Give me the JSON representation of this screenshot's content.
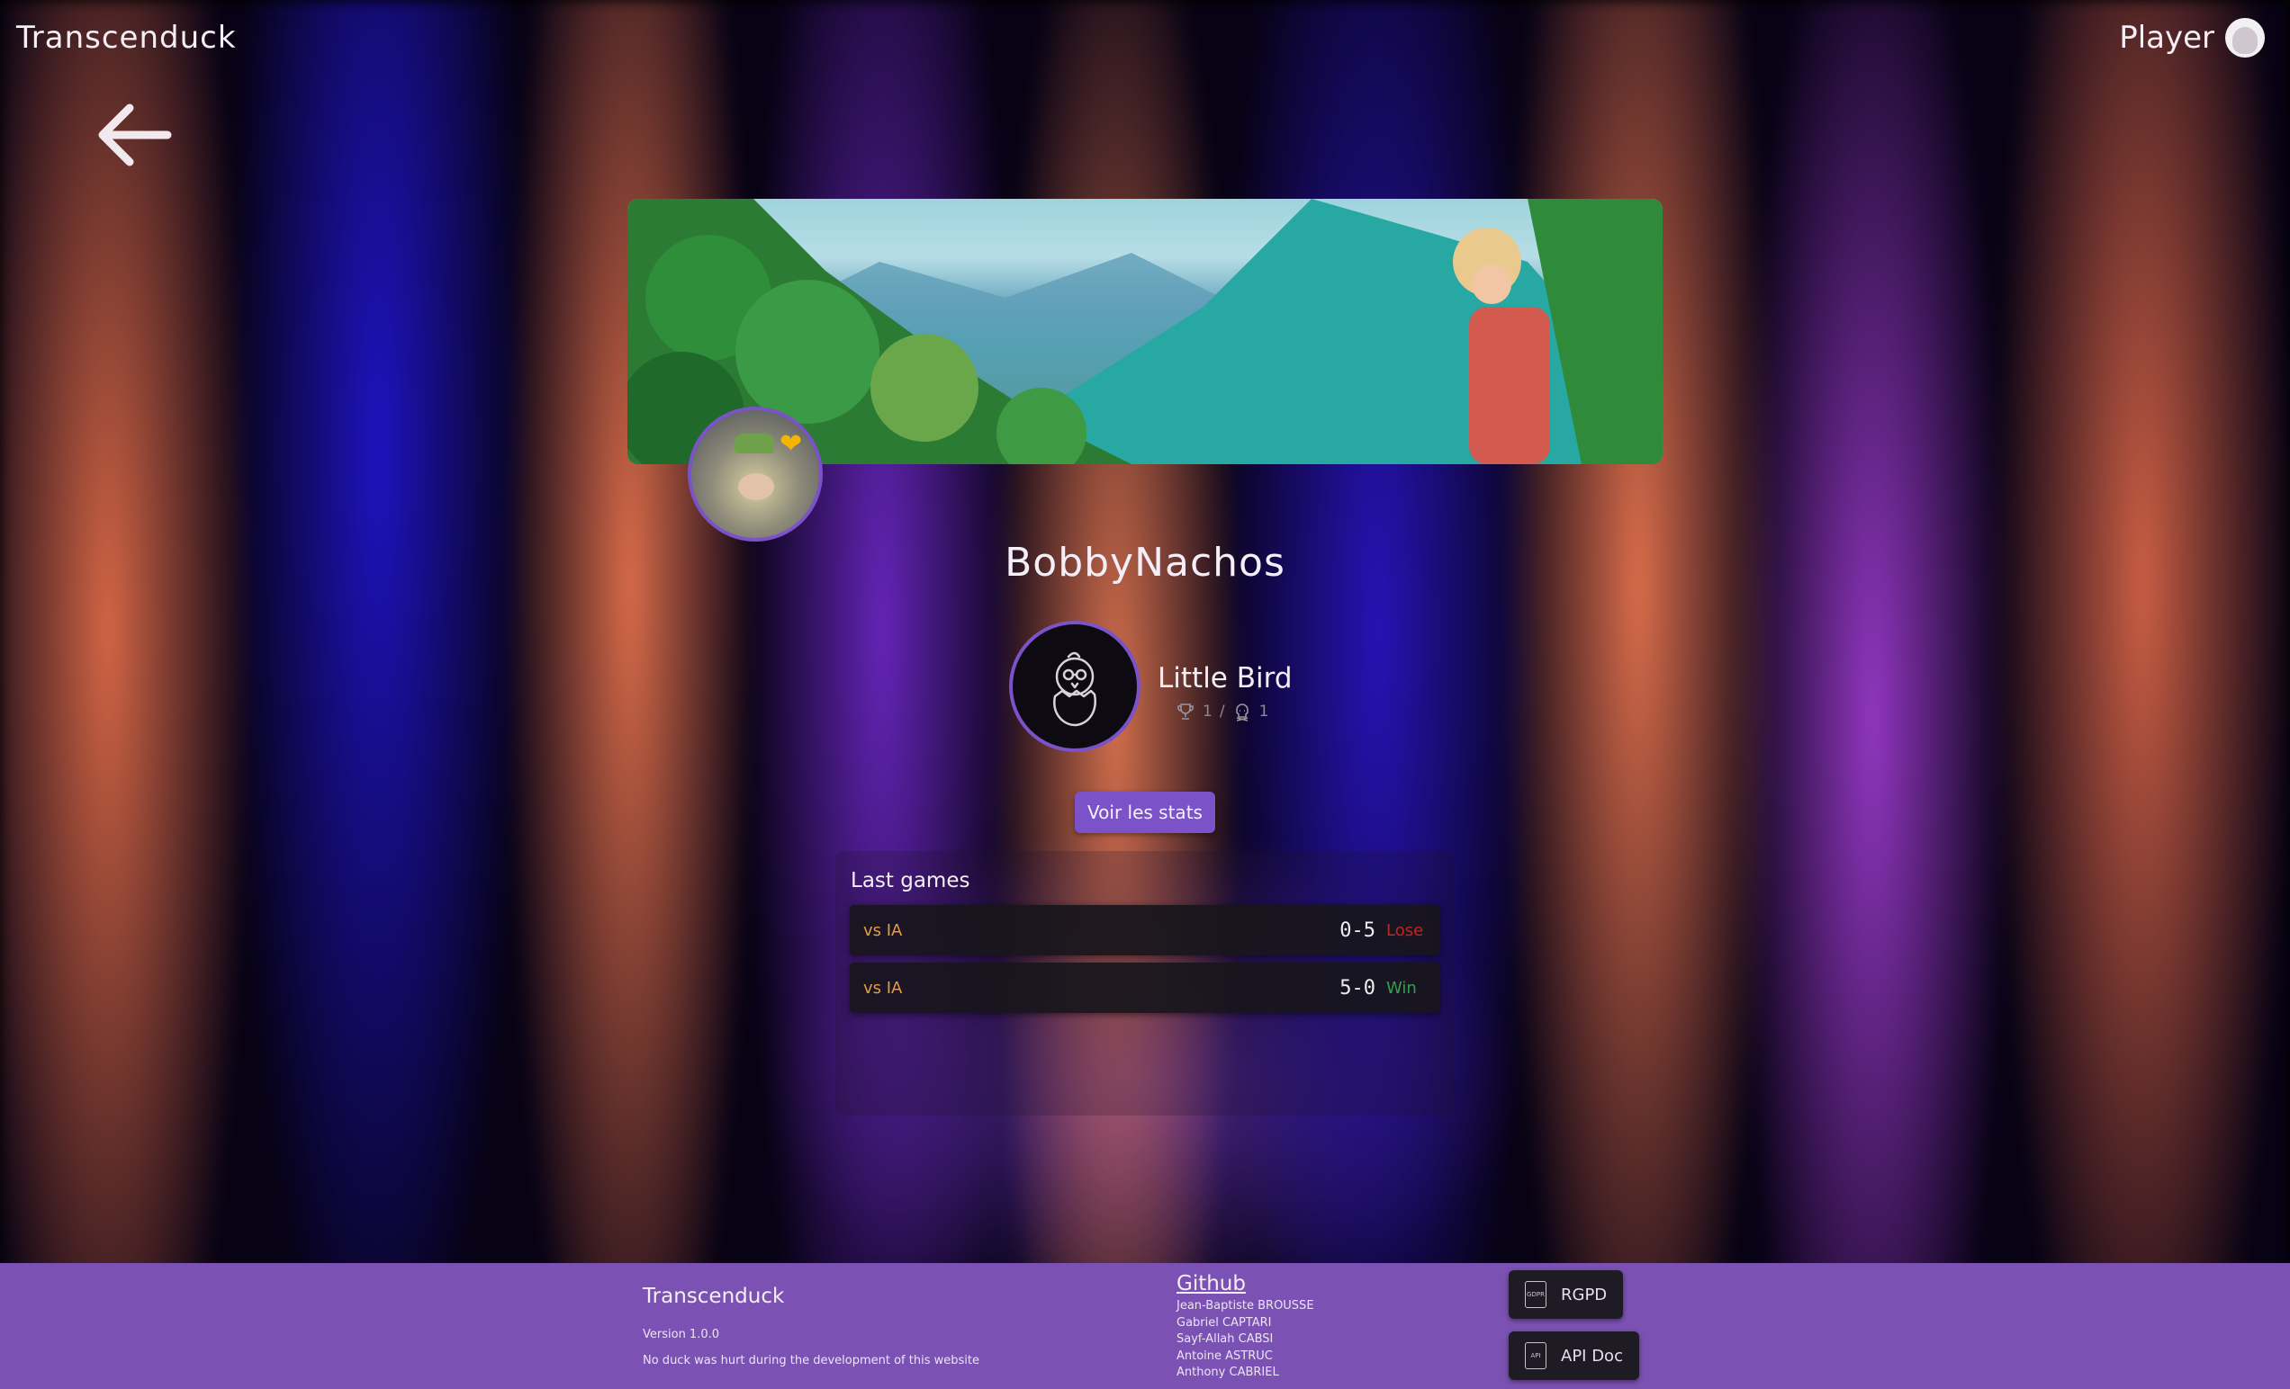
{
  "header": {
    "brand": "Transcenduck",
    "player_label": "Player"
  },
  "profile": {
    "username": "BobbyNachos",
    "rank_name": "Little Bird",
    "wins": "1",
    "separator": "/",
    "losses": "1",
    "stats_button": "Voir les stats"
  },
  "games": {
    "title": "Last games",
    "rows": [
      {
        "opponent": "vs IA",
        "score": "0-5",
        "result": "Lose"
      },
      {
        "opponent": "vs IA",
        "score": "5-0",
        "result": "Win"
      }
    ]
  },
  "footer": {
    "title": "Transcenduck",
    "version": "Version 1.0.0",
    "note": "No duck was hurt during the development of this website",
    "github_label": "Github",
    "authors": [
      "Jean-Baptiste BROUSSE",
      "Gabriel CAPTARI",
      "Sayf-Allah CABSI",
      "Antoine ASTRUC",
      "Anthony CABRIEL"
    ],
    "rgpd_label": "RGPD",
    "rgpd_icon_text": "GDPR",
    "api_label": "API Doc",
    "api_icon_text": "API"
  },
  "colors": {
    "accent": "#7b52c7",
    "footer": "#7b52b3",
    "lose": "#c2241f",
    "win": "#2fa14c",
    "opponent": "#e89a40",
    "favorite": "#f4b400"
  },
  "icons": {
    "back": "arrow-left-icon",
    "player": "user-avatar-icon",
    "favorite": "heart-icon",
    "rank": "hatching-chick-icon",
    "wins": "trophy-icon",
    "losses": "skull-icon",
    "footer_docs": "document-icon"
  }
}
